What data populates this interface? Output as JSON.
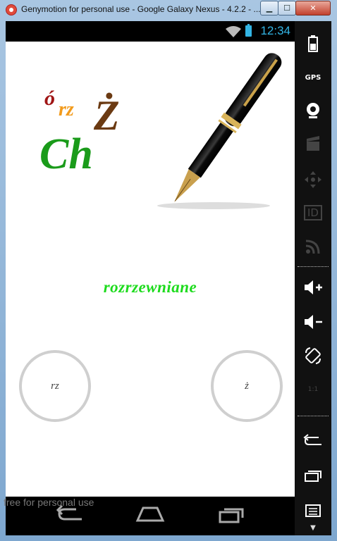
{
  "window": {
    "title": "Genymotion for personal use - Google Galaxy Nexus - 4.2.2 - ...",
    "min_label": "▁",
    "max_label": "☐",
    "close_label": "✕"
  },
  "status_bar": {
    "time": "12:34"
  },
  "app": {
    "logo_letters": [
      "ó",
      "rz",
      "Ż",
      "Ch"
    ],
    "word": "rozrzewniane",
    "option_left": "rz",
    "option_right": "ż"
  },
  "watermark": "free for personal use",
  "sidebar": {
    "gps_label": "GPS",
    "id_label": "ID",
    "scale_label": "1:1",
    "icons": [
      "battery-icon",
      "gps-icon",
      "webcam-icon",
      "video-icon",
      "dpad-icon",
      "id-icon",
      "rss-icon",
      "volume-up-icon",
      "volume-down-icon",
      "rotate-icon",
      "scale-icon",
      "back-icon",
      "recents-icon",
      "menu-icon"
    ]
  },
  "colors": {
    "accent": "#33b5e5",
    "word_color": "#1ddb1d",
    "letter_o": "#a01515",
    "letter_rz": "#f29b1d",
    "letter_z": "#6b3a12",
    "letter_ch": "#1a9b1a"
  }
}
